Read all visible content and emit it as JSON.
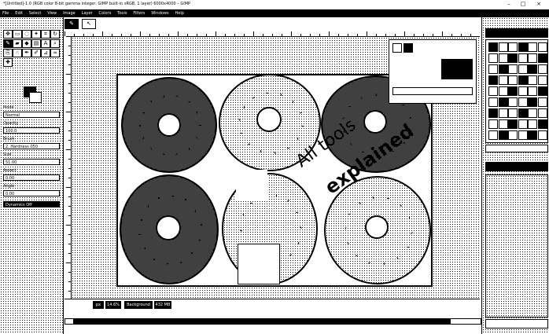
{
  "window": {
    "title": "*[Untitled]-1.0 (RGB color 8-bit gamma integer, GIMP built-in sRGB, 1 layer) 6000x4000 – GIMP",
    "controls": [
      "–",
      "□",
      "×"
    ]
  },
  "menu": {
    "items": [
      "File",
      "Edit",
      "Select",
      "View",
      "Image",
      "Layer",
      "Colors",
      "Tools",
      "Filters",
      "Windows",
      "Help"
    ]
  },
  "toolbox": {
    "options_labels": [
      "Mode",
      "Opacity",
      "Brush",
      "Size",
      "Aspect",
      "Angle",
      "Spacing",
      "Hardness"
    ],
    "options_values": [
      "Normal",
      "100.0",
      "2. Hardness 050",
      "51.00",
      "0.00",
      "0.00",
      "10.0",
      "50.0"
    ],
    "checkbox_label": "Dynamics Off"
  },
  "canvas": {
    "overlay_line1": "All tools",
    "overlay_line2": "explained"
  },
  "status": {
    "unit": "px",
    "zoom": "14.6%",
    "info": "Background",
    "size": "432 MB"
  },
  "colors": {
    "ink": "#000000",
    "paper": "#ffffff"
  }
}
